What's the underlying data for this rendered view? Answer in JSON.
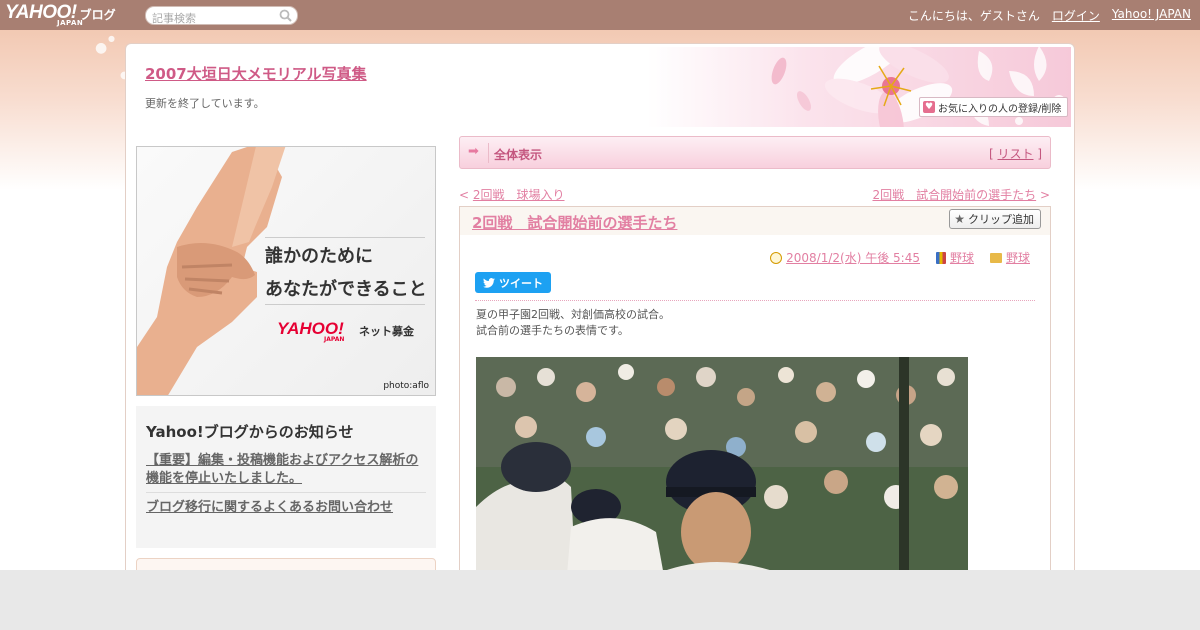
{
  "topbar": {
    "logo_text": "YAHOO!",
    "logo_japan": "JAPAN",
    "logo_suffix": "ブログ",
    "search_placeholder": "記事検索",
    "greeting": "こんにちは、ゲストさん",
    "login_label": "ログイン",
    "yahoo_japan_label": "Yahoo! JAPAN",
    "bar_color": "#a87f72"
  },
  "header": {
    "blog_title": "2007大垣日大メモリアル写真集",
    "blog_description": "更新を終了しています。",
    "favorite_button": "お気に入りの人の登録/削除",
    "title_color": "#cf5a86"
  },
  "banner": {
    "line1": "誰かのために",
    "line2": "あなたができること",
    "logo": "YAHOO!",
    "logo_japan": "JAPAN",
    "service": "ネット募金",
    "credit": "photo:aflo"
  },
  "notice": {
    "title": "Yahoo!ブログからのお知らせ",
    "links": [
      "【重要】編集・投稿機能およびアクセス解析の機能を停止いたしました。",
      "ブログ移行に関するよくあるお問い合わせ"
    ]
  },
  "nav": {
    "all_label": "全体表示",
    "list_label": "リスト",
    "prev_link": "2回戦　球場入り",
    "next_link": "2回戦　試合開始前の選手たち",
    "accent_color": "#e27fa2"
  },
  "article": {
    "title": "2回戦　試合開始前の選手たち",
    "clip_button": "クリップ追加",
    "date": "2008/1/2(水) 午後 5:45",
    "category": "野球",
    "folder": "野球",
    "tweet_label": "ツイート",
    "body_lines": [
      "夏の甲子園2回戦、対創価高校の試合。",
      "試合前の選手たちの表情です。"
    ]
  }
}
